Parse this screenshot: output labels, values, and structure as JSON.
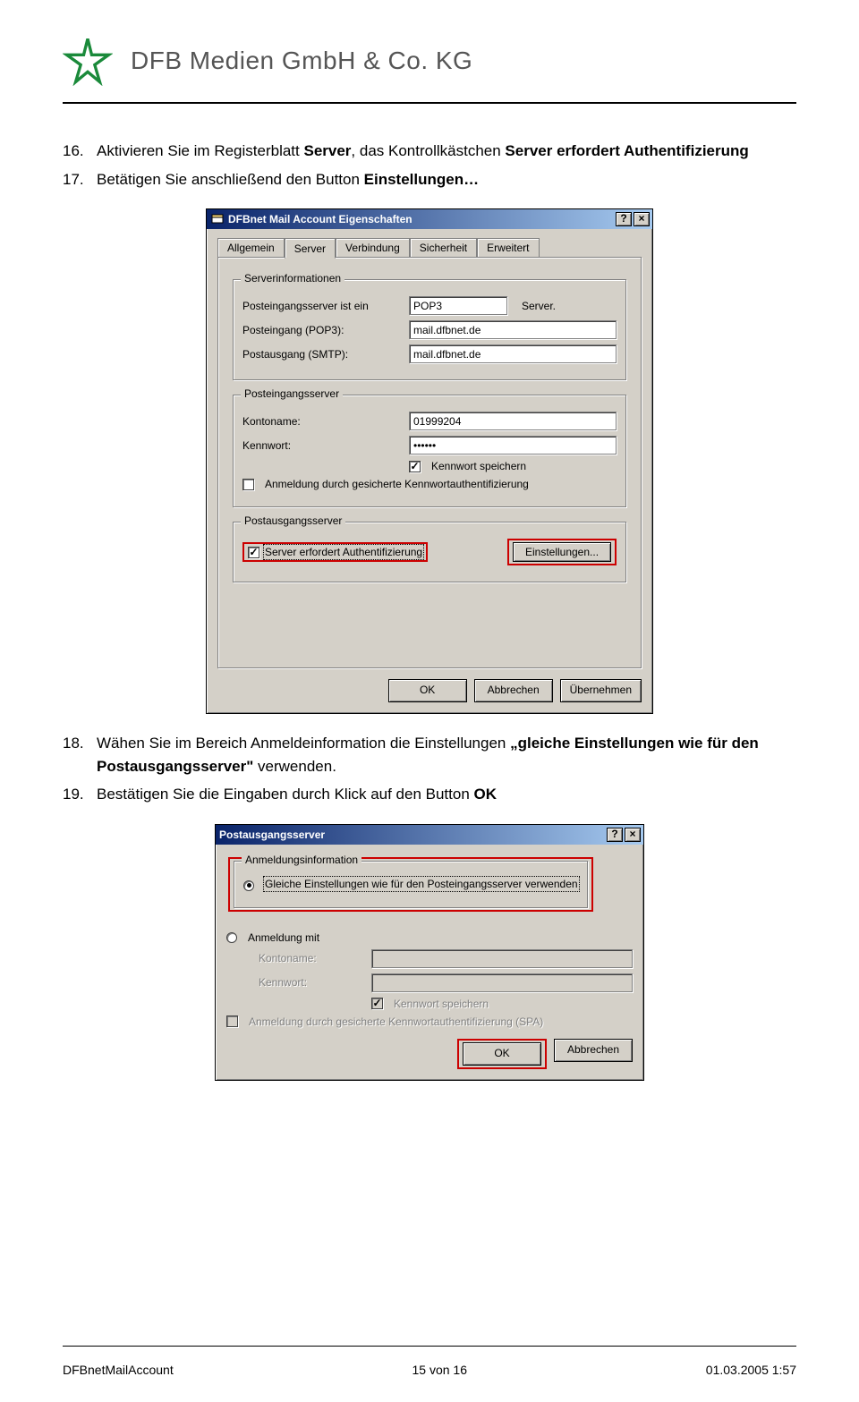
{
  "doc": {
    "company": "DFB Medien GmbH & Co. KG",
    "footer_left": "DFBnetMailAccount",
    "footer_center": "15 von 16",
    "footer_right": "01.03.2005 1:57"
  },
  "steps_a": {
    "s16_num": "16.",
    "s16_txt_a": "Aktivieren Sie im Registerblatt ",
    "s16_txt_b": "Server",
    "s16_txt_c": ", das Kontrollkästchen ",
    "s16_txt_d": "Server erfordert Authentifizierung",
    "s17_num": "17.",
    "s17_txt_a": "Betätigen Sie anschließend den Button ",
    "s17_txt_b": "Einstellungen…"
  },
  "steps_b": {
    "s18_num": "18.",
    "s18_txt_a": "Wähen Sie im Bereich Anmeldeinformation die Einstellungen ",
    "s18_txt_b": "„gleiche Einstellungen wie für den Postausgangsserver\"",
    "s18_txt_c": " verwenden.",
    "s19_num": "19.",
    "s19_txt_a": "Bestätigen Sie die Eingaben durch Klick auf den Button ",
    "s19_txt_b": "OK"
  },
  "dlg1": {
    "title": "DFBnet Mail Account Eigenschaften",
    "help_btn": "?",
    "close_btn": "×",
    "tabs": {
      "t0": "Allgemein",
      "t1": "Server",
      "t2": "Verbindung",
      "t3": "Sicherheit",
      "t4": "Erweitert"
    },
    "group_serverinfo": "Serverinformationen",
    "lbl_in_is": "Posteingangsserver ist ein",
    "val_in_type": "POP3",
    "suffix_server": "Server.",
    "lbl_in": "Posteingang (POP3):",
    "val_in": "mail.dfbnet.de",
    "lbl_out": "Postausgang (SMTP):",
    "val_out": "mail.dfbnet.de",
    "group_inserver": "Posteingangsserver",
    "lbl_account": "Kontoname:",
    "val_account": "01999204",
    "lbl_pass": "Kennwort:",
    "val_pass": "••••••",
    "chk_savepw": "Kennwort speichern",
    "chk_spa": "Anmeldung durch gesicherte Kennwortauthentifizierung",
    "group_outserver": "Postausgangsserver",
    "chk_auth": "Server erfordert Authentifizierung",
    "btn_settings": "Einstellungen...",
    "btn_ok": "OK",
    "btn_cancel": "Abbrechen",
    "btn_apply": "Übernehmen"
  },
  "dlg2": {
    "title": "Postausgangsserver",
    "help_btn": "?",
    "close_btn": "×",
    "group_login": "Anmeldungsinformation",
    "radio_same": "Gleiche Einstellungen wie für den Posteingangsserver verwenden",
    "radio_with": "Anmeldung mit",
    "lbl_account": "Kontoname:",
    "lbl_pass": "Kennwort:",
    "chk_savepw": "Kennwort speichern",
    "chk_spa": "Anmeldung durch gesicherte Kennwortauthentifizierung (SPA)",
    "btn_ok": "OK",
    "btn_cancel": "Abbrechen"
  }
}
